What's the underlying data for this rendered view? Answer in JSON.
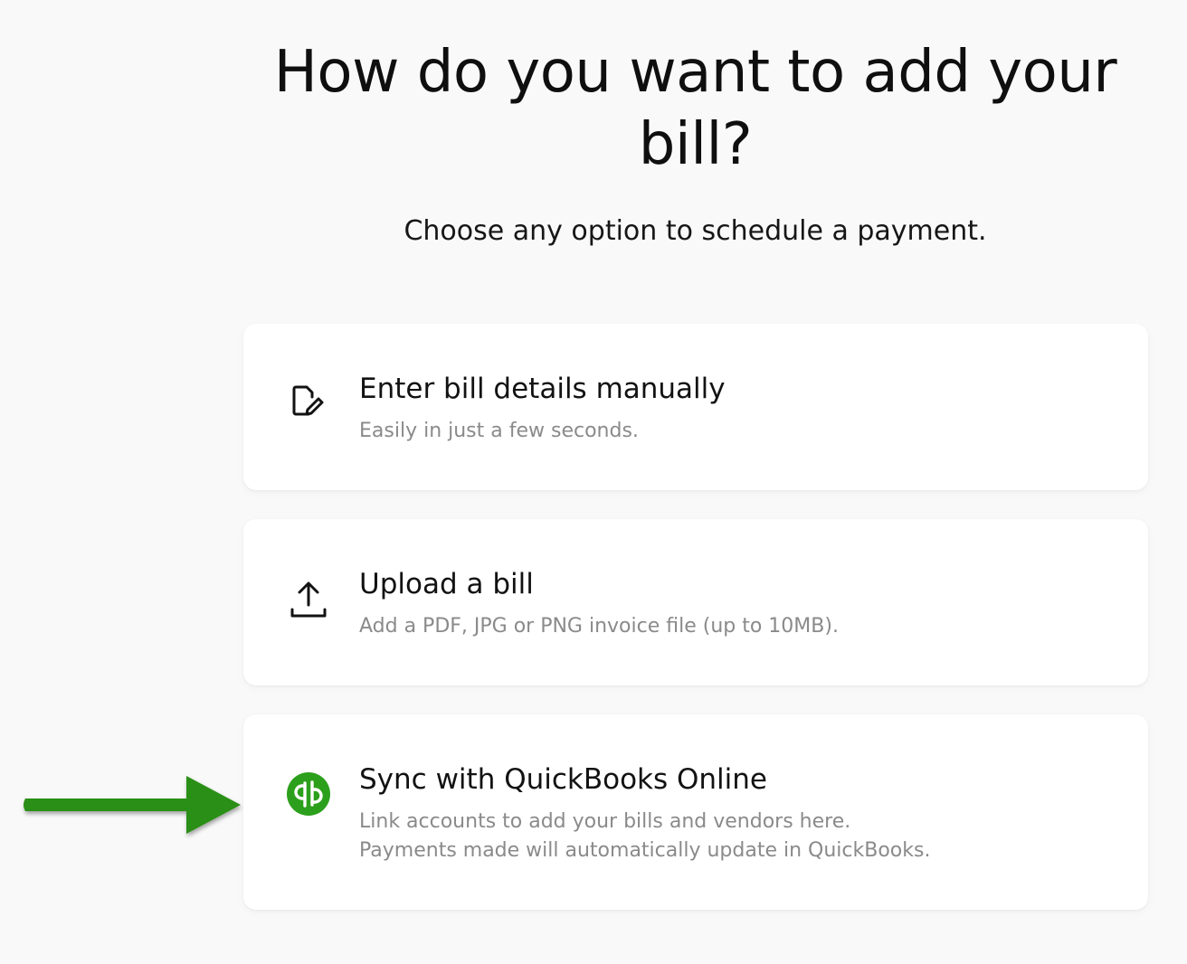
{
  "heading": {
    "title": "How do you want to add your bill?",
    "subtitle": "Choose any option to schedule a payment."
  },
  "options": [
    {
      "title": "Enter bill details manually",
      "description_lines": [
        "Easily in just a few seconds."
      ],
      "icon": "document-edit-icon"
    },
    {
      "title": "Upload a bill",
      "description_lines": [
        "Add a PDF, JPG or PNG invoice file (up to 10MB)."
      ],
      "icon": "upload-icon"
    },
    {
      "title": "Sync with QuickBooks Online",
      "description_lines": [
        "Link accounts to add your bills and vendors here.",
        "Payments made will automatically update in QuickBooks."
      ],
      "icon": "quickbooks-logo-icon"
    }
  ],
  "annotation": {
    "icon": "green-arrow-icon",
    "color": "#2a8f17"
  },
  "colors": {
    "background": "#f9f9f9",
    "card": "#ffffff",
    "quickbooks_green": "#2ca01c",
    "description_text": "#8a8a8a"
  }
}
